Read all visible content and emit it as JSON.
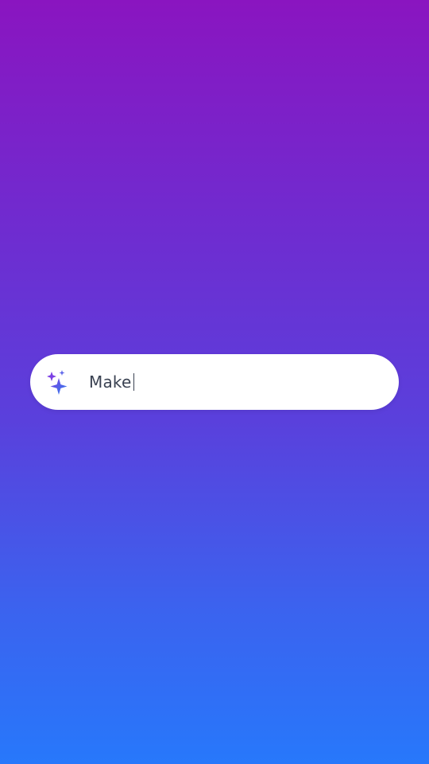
{
  "prompt_bar": {
    "icon": "sparkle-icon",
    "value": "Make"
  },
  "colors": {
    "gradient_top": "#8a15c0",
    "gradient_bottom": "#2778fb",
    "sparkle_purple": "#7b3fe4",
    "sparkle_blue": "#2f80ed",
    "text": "#3a4252"
  }
}
